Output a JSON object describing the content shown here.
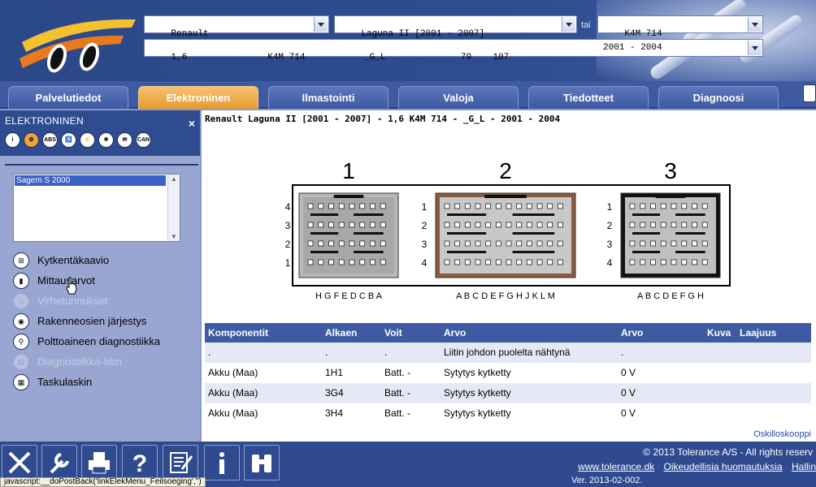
{
  "header": {
    "make": "Renault",
    "model": "Laguna II [2001 - 2007]",
    "or_label": "tai",
    "engine_code": "K4M 714",
    "variant_row": "1,6               K4M 714           _G_L              79    107",
    "years": "2001 - 2004"
  },
  "tabs": [
    "Palvelutiedot",
    "Elektroninen",
    "Ilmastointi",
    "Valoja",
    "Tiedotteet",
    "Diagnoosi"
  ],
  "active_tab": "Elektroninen",
  "left_panel": {
    "title": "ELEKTRONINEN",
    "close": "×",
    "category_icons": [
      {
        "name": "info-icon",
        "glyph": "i"
      },
      {
        "name": "engine-icon",
        "glyph": "⚙"
      },
      {
        "name": "abs-icon",
        "glyph": "ABS"
      },
      {
        "name": "airbag-icon",
        "glyph": "♿"
      },
      {
        "name": "wiring-icon",
        "glyph": "⚡"
      },
      {
        "name": "climate-icon",
        "glyph": "❄"
      },
      {
        "name": "mail-icon",
        "glyph": "✉"
      },
      {
        "name": "can-icon",
        "glyph": "CAN"
      }
    ],
    "systems": [
      "Sagem S 2000"
    ],
    "menu": [
      {
        "label": "Kytkentäkaavio",
        "icon": "wiring-diagram-icon",
        "glyph": "⊞",
        "enabled": true
      },
      {
        "label": "Mittausarvot",
        "icon": "measurement-icon",
        "glyph": "▮",
        "enabled": true
      },
      {
        "label": "Virhetunnukset",
        "icon": "warning-icon",
        "glyph": "⚠",
        "enabled": false
      },
      {
        "label": "Rakenneosien järjestys",
        "icon": "location-icon",
        "glyph": "◉",
        "enabled": true
      },
      {
        "label": "Polttoaineen diagnostiikka",
        "icon": "fuel-icon",
        "glyph": "⚲",
        "enabled": true
      },
      {
        "label": "Diagnostiikka-liitin",
        "icon": "connector-icon",
        "glyph": "⊡",
        "enabled": false
      },
      {
        "label": "Taskulaskin",
        "icon": "calculator-icon",
        "glyph": "▦",
        "enabled": true
      }
    ]
  },
  "main": {
    "title": "Renault Laguna II [2001 - 2007] - 1,6 K4M 714 - _G_L - 2001 - 2004",
    "connectors": [
      {
        "number": "1",
        "letters": "H G F E D C B A",
        "rows": [
          "4",
          "3",
          "2",
          "1"
        ],
        "color": "#b0b0b0"
      },
      {
        "number": "2",
        "letters": "A B C D E F G H J K L M",
        "rows": [
          "1",
          "2",
          "3",
          "4"
        ],
        "color": "#8a5a3c"
      },
      {
        "number": "3",
        "letters": "A B C D E F G H",
        "rows": [
          "1",
          "2",
          "3",
          "4"
        ],
        "color": "#111111"
      }
    ],
    "table": {
      "headers": [
        "Komponentit",
        "Alkaen",
        "Voit",
        "Arvo",
        "Arvo",
        "Kuva",
        "Laajuus"
      ],
      "rows": [
        [
          ".",
          ".",
          ".",
          "Liitin johdon puolelta nähtynä",
          ".",
          "",
          ""
        ],
        [
          "Akku (Maa)",
          "1H1",
          "Batt. -",
          "Sytytys kytketty",
          "0 V",
          "",
          ""
        ],
        [
          "Akku (Maa)",
          "3G4",
          "Batt. -",
          "Sytytys kytketty",
          "0 V",
          "",
          ""
        ],
        [
          "Akku (Maa)",
          "3H4",
          "Batt. -",
          "Sytytys kytketty",
          "0 V",
          "",
          ""
        ]
      ],
      "footer_link": "Oskilloskooppi"
    }
  },
  "footer": {
    "copyright": "© 2013 Tolerance A/S - All rights reserv",
    "link1": "www.tolerance.dk",
    "link2": "Oikeudellisia huomautuksia",
    "link3": "Hallin",
    "version": "Ver. 2013-02-002.",
    "status_text": "javascript:__doPostBack('linkElekMenu_Feilsoeging','')"
  }
}
